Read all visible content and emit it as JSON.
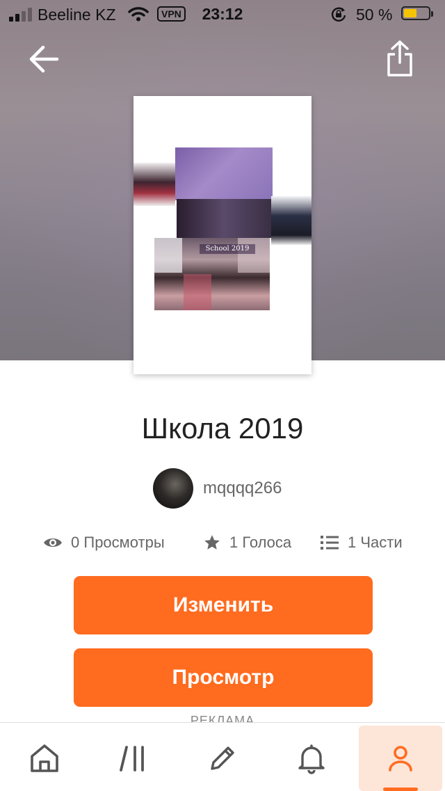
{
  "status_bar": {
    "carrier": "Beeline KZ",
    "vpn": "VPN",
    "time": "23:12",
    "battery_percent": "50 %",
    "battery_level": 0.5,
    "signal_bars": 2
  },
  "nav": {
    "back_icon": "arrow-left-icon",
    "share_icon": "share-icon"
  },
  "cover": {
    "text": "School 2019"
  },
  "story": {
    "title": "Школа 2019",
    "author": "mqqqq266"
  },
  "stats": {
    "views_value": "0",
    "views_label": "Просмотры",
    "votes_value": "1",
    "votes_label": "Голоса",
    "parts_value": "1",
    "parts_label": "Части"
  },
  "buttons": {
    "edit": "Изменить",
    "preview": "Просмотр"
  },
  "ad_label": "РЕКЛАМА",
  "tabbar": {
    "items": [
      "home-icon",
      "library-icon",
      "write-icon",
      "notifications-icon",
      "profile-icon"
    ],
    "active": "profile-icon"
  },
  "colors": {
    "accent": "#ff6b1f",
    "active_tab_bg": "#fde5d8"
  }
}
